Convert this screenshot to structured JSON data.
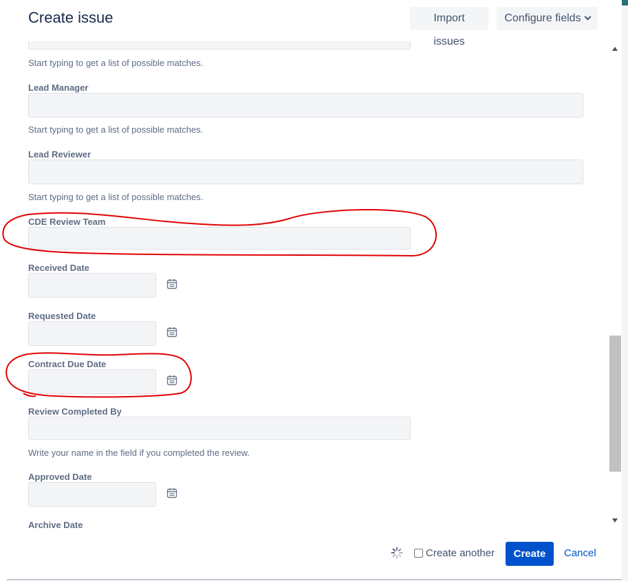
{
  "dialog": {
    "title": "Create issue",
    "import_label": "Import issues",
    "configure_label": "Configure fields"
  },
  "fields": {
    "partial_hint": "Start typing to get a list of possible matches.",
    "lead_manager": {
      "label": "Lead Manager",
      "value": "",
      "hint": "Start typing to get a list of possible matches."
    },
    "lead_reviewer": {
      "label": "Lead Reviewer",
      "value": "",
      "hint": "Start typing to get a list of possible matches."
    },
    "cde_review_team": {
      "label": "CDE Review Team",
      "value": ""
    },
    "received_date": {
      "label": "Received Date",
      "value": ""
    },
    "requested_date": {
      "label": "Requested Date",
      "value": ""
    },
    "contract_due_date": {
      "label": "Contract Due Date",
      "value": ""
    },
    "review_completed_by": {
      "label": "Review Completed By",
      "value": "",
      "hint": "Write your name in the field if you completed the review."
    },
    "approved_date": {
      "label": "Approved Date",
      "value": ""
    },
    "archive_date": {
      "label": "Archive Date"
    }
  },
  "footer": {
    "create_another_label": "Create another",
    "create_another_checked": false,
    "create_label": "Create",
    "cancel_label": "Cancel"
  },
  "icons": {
    "calendar": "calendar-icon",
    "spinner": "loading-spinner-icon",
    "chevron": "chevron-down-icon"
  },
  "colors": {
    "primary": "#0052cc",
    "annotation": "#e00000"
  }
}
